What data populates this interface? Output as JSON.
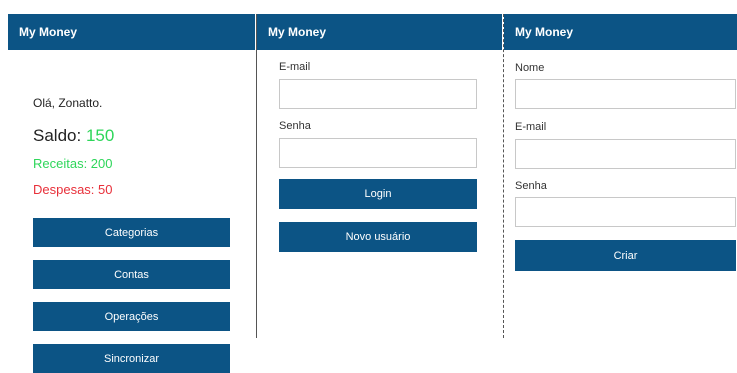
{
  "dashboard": {
    "app_title": "My Money",
    "greeting": "Olá, Zonatto.",
    "saldo_label": "Saldo:",
    "saldo_value": "150",
    "receitas": "Receitas: 200",
    "despesas": "Despesas: 50",
    "buttons": [
      "Categorias",
      "Contas",
      "Operações",
      "Sincronizar"
    ]
  },
  "login": {
    "app_title": "My Money",
    "email_label": "E-mail",
    "email_value": "",
    "senha_label": "Senha",
    "senha_value": "",
    "login_button": "Login",
    "new_user_button": "Novo usuário"
  },
  "register": {
    "app_title": "My Money",
    "nome_label": "Nome",
    "nome_value": "",
    "email_label": "E-mail",
    "email_value": "",
    "senha_label": "Senha",
    "senha_value": "",
    "create_button": "Criar"
  },
  "colors": {
    "header": "#0c5485",
    "income": "#2ed65a",
    "expense": "#e8303a"
  }
}
